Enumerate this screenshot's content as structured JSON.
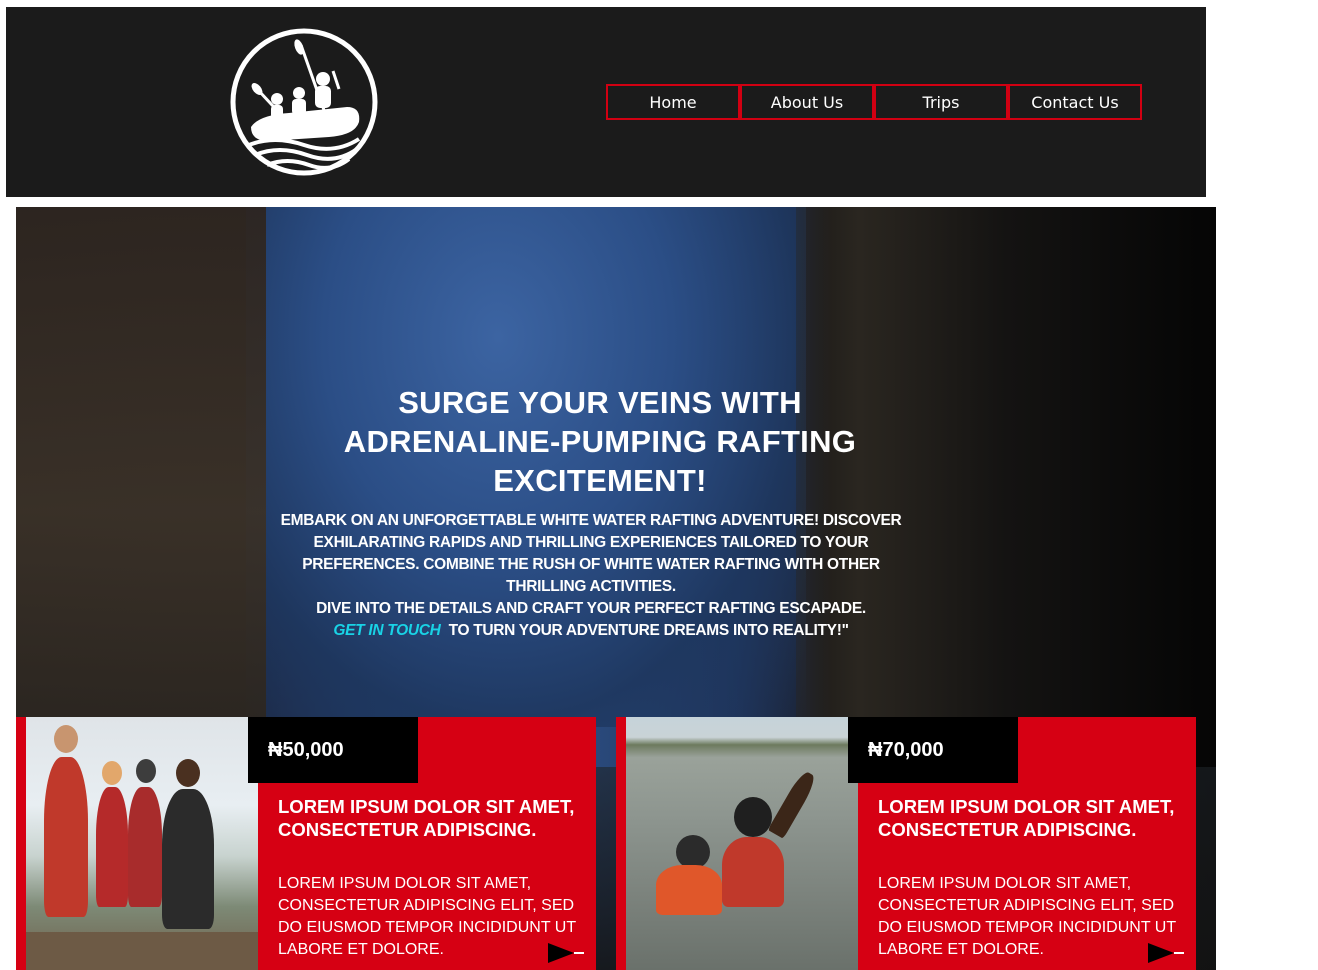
{
  "nav": {
    "items": [
      {
        "label": "Home"
      },
      {
        "label": "About Us"
      },
      {
        "label": "Trips"
      },
      {
        "label": "Contact Us"
      }
    ]
  },
  "logo": {
    "icon": "rafting-boat-logo"
  },
  "hero": {
    "title": "SURGE YOUR VEINS WITH ADRENALINE-PUMPING RAFTING EXCITEMENT!",
    "paragraph": "EMBARK ON AN UNFORGETTABLE WHITE WATER RAFTING ADVENTURE! DISCOVER EXHILARATING RAPIDS AND THRILLING EXPERIENCES TAILORED TO YOUR PREFERENCES. COMBINE THE RUSH OF WHITE WATER RAFTING WITH OTHER THRILLING ACTIVITIES.",
    "line2": "DIVE INTO THE DETAILS AND CRAFT YOUR PERFECT RAFTING ESCAPADE.",
    "cta_link": "GET IN TOUCH",
    "cta_rest": "TO TURN YOUR ADVENTURE DREAMS INTO REALITY!\""
  },
  "cards": [
    {
      "price": "₦50,000",
      "title": "LOREM IPSUM DOLOR SIT AMET, CONSECTETUR ADIPISCING.",
      "text": "LOREM IPSUM DOLOR SIT AMET, CONSECTETUR ADIPISCING ELIT, SED DO EIUSMOD TEMPOR INCIDIDUNT UT LABORE ET DOLORE."
    },
    {
      "price": "₦70,000",
      "title": "LOREM IPSUM DOLOR SIT AMET, CONSECTETUR ADIPISCING.",
      "text": "LOREM IPSUM DOLOR SIT AMET, CONSECTETUR ADIPISCING ELIT, SED DO EIUSMOD TEMPOR INCIDIDUNT UT LABORE ET DOLORE."
    }
  ],
  "colors": {
    "header_bg": "#1b1b1b",
    "accent_red": "#d60013",
    "nav_border": "#d10012",
    "link_cyan": "#19d3e6"
  }
}
